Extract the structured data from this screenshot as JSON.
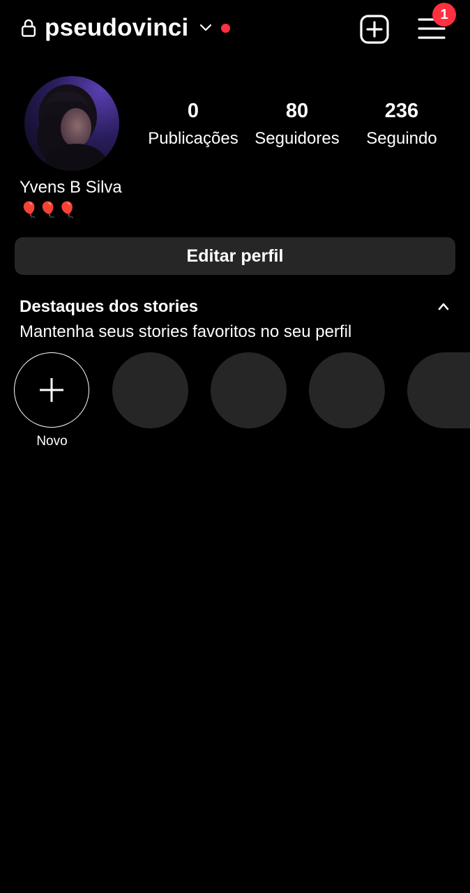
{
  "header": {
    "username": "pseudovinci",
    "notification_count": "1",
    "icons": {
      "lock": "lock-icon",
      "switch": "chevron-down-icon",
      "create": "plus-square-icon",
      "menu": "hamburger-menu-icon"
    },
    "status_dot_color": "#ff3040"
  },
  "profile": {
    "stats": [
      {
        "value": "0",
        "label": "Publicações"
      },
      {
        "value": "80",
        "label": "Seguidores"
      },
      {
        "value": "236",
        "label": "Seguindo"
      }
    ],
    "display_name": "Yvens B Silva",
    "bio": "🎈🎈🎈",
    "edit_button": "Editar perfil"
  },
  "highlights": {
    "title": "Destaques dos stories",
    "subtitle": "Mantenha seus stories favoritos no seu perfil",
    "new_label": "Novo",
    "placeholder_count": 4
  },
  "colors": {
    "background": "#000000",
    "surface": "#262626",
    "text": "#ffffff",
    "accent": "#ff3040"
  }
}
